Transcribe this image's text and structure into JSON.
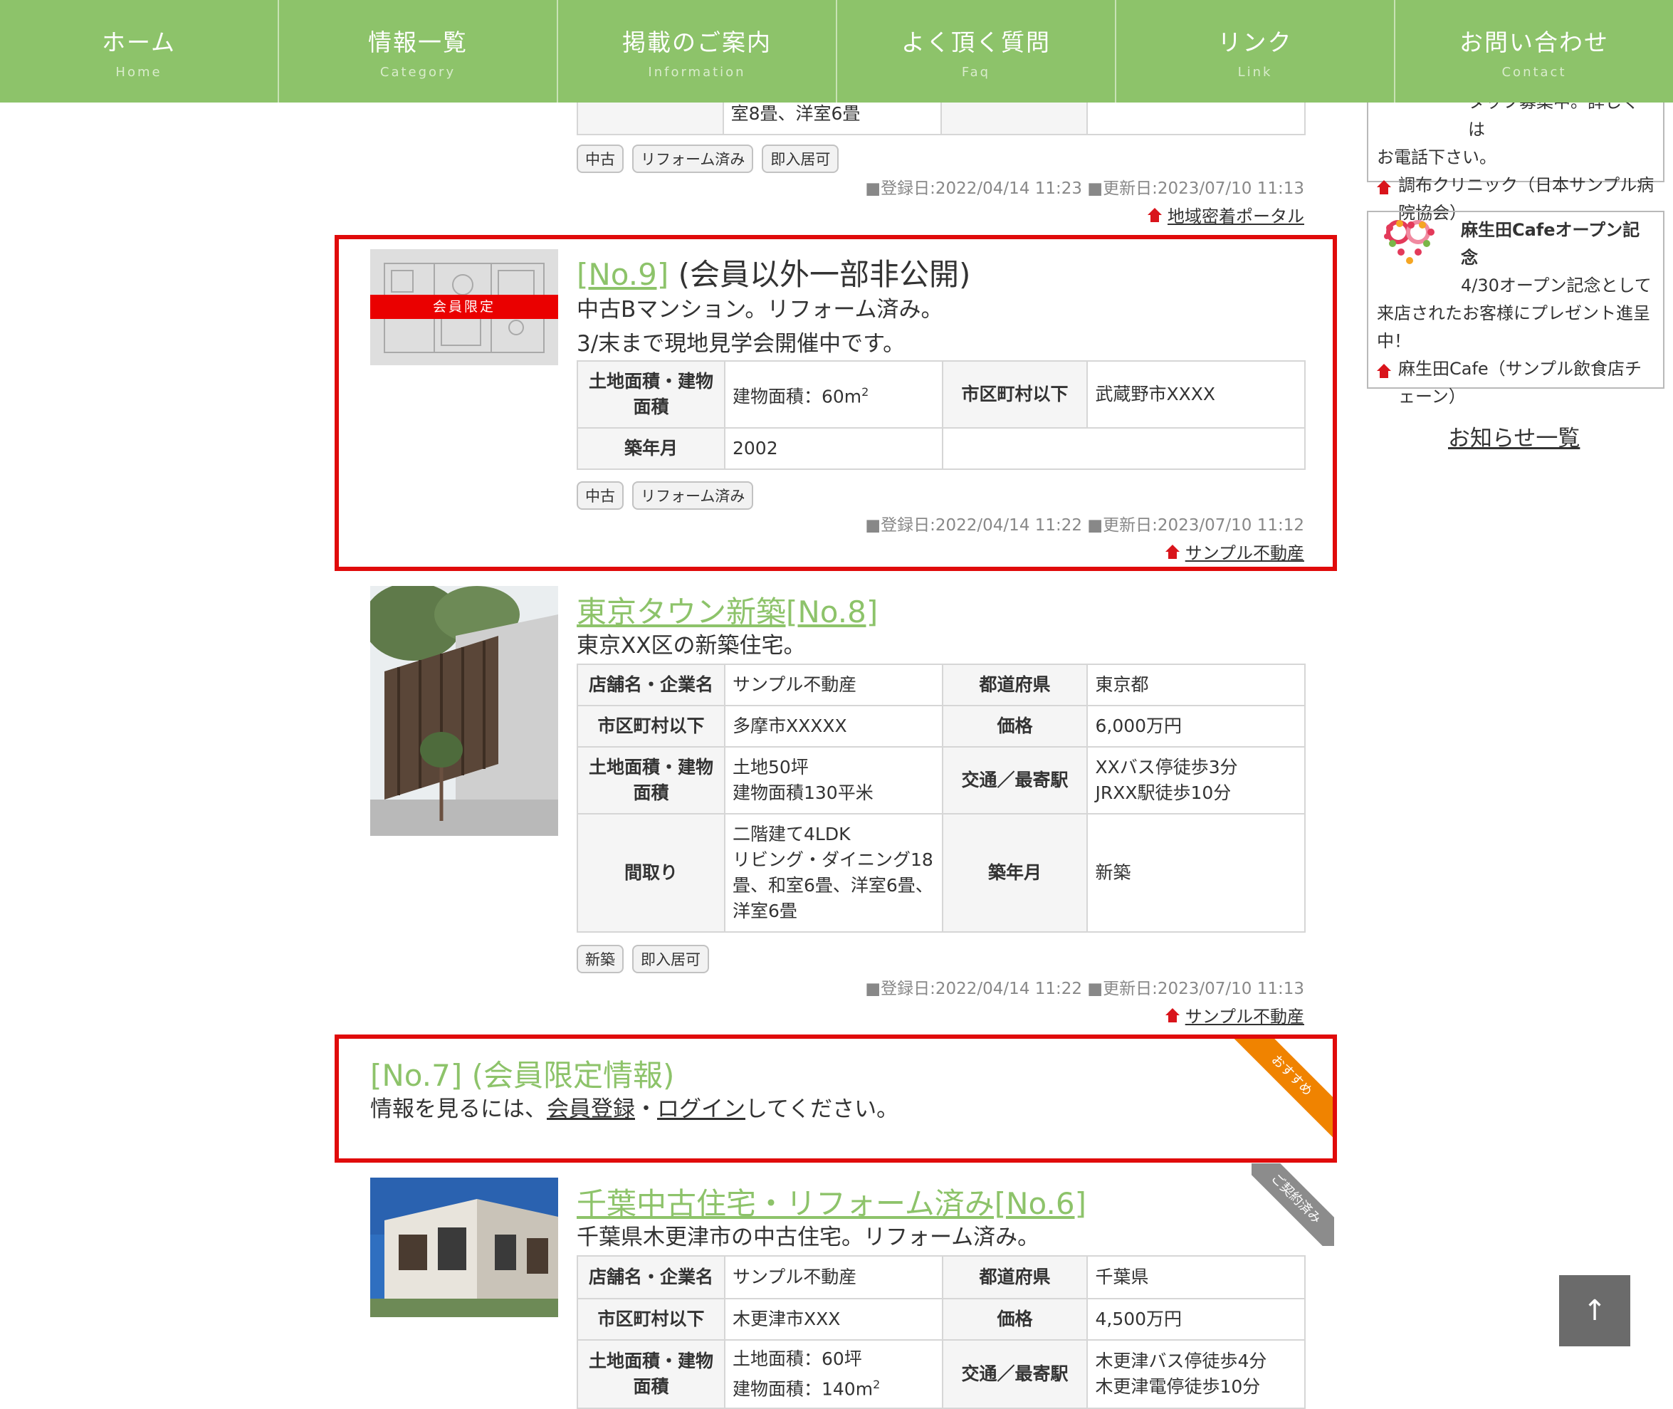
{
  "nav": [
    {
      "jp": "ホーム",
      "en": "Home"
    },
    {
      "jp": "情報一覧",
      "en": "Category"
    },
    {
      "jp": "掲載のご案内",
      "en": "Information"
    },
    {
      "jp": "よく頂く質問",
      "en": "Faq"
    },
    {
      "jp": "リンク",
      "en": "Link"
    },
    {
      "jp": "お問い合わせ",
      "en": "Contact"
    }
  ],
  "prev": {
    "madori_tail": "室8畳、洋室6畳",
    "tags": [
      "中古",
      "リフォーム済み",
      "即入居可"
    ],
    "dates": "■登録日:2022/04/14 11:23 ■更新日:2023/07/10 11:13",
    "source": "地域密着ポータル"
  },
  "no9": {
    "badge": "会員限定",
    "no": "[No.9]",
    "title_rest": "(会員以外一部非公開)",
    "desc1": "中古Bマンション。リフォーム済み。",
    "desc2": "3/末まで現地見学会開催中です。",
    "labels": {
      "area": "土地面積・建物面積",
      "city": "市区町村以下",
      "year": "築年月"
    },
    "area_prefix": "建物面積：60m",
    "area_sup": "2",
    "city": "武蔵野市XXXX",
    "year": "2002",
    "tags": [
      "中古",
      "リフォーム済み"
    ],
    "dates": "■登録日:2022/04/14 11:22 ■更新日:2023/07/10 11:12",
    "source": "サンプル不動産"
  },
  "no8": {
    "title": "東京タウン新築[No.8]",
    "desc": "東京XX区の新築住宅。",
    "labels": {
      "shop": "店舗名・企業名",
      "pref": "都道府県",
      "city": "市区町村以下",
      "price": "価格",
      "area": "土地面積・建物面積",
      "access": "交通／最寄駅",
      "madori": "間取り",
      "year": "築年月"
    },
    "shop": "サンプル不動産",
    "pref": "東京都",
    "city": "多摩市XXXXX",
    "price": "6,000万円",
    "area1": "土地50坪",
    "area2": "建物面積130平米",
    "access1": "XXバス停徒歩3分",
    "access2": "JRXX駅徒歩10分",
    "madori": [
      "二階建て4LDK",
      "リビング・ダイニング18",
      "畳、和室6畳、洋室6畳、",
      "洋室6畳"
    ],
    "year": "新築",
    "tags": [
      "新築",
      "即入居可"
    ],
    "dates": "■登録日:2022/04/14 11:22 ■更新日:2023/07/10 11:13",
    "source": "サンプル不動産"
  },
  "no7": {
    "title": "[No.7] (会員限定情報)",
    "text_pre": "情報を見るには、",
    "link_register": "会員登録",
    "sep": "・",
    "link_login": "ログイン",
    "text_post": "してください。",
    "ribbon": "おすすめ"
  },
  "no6": {
    "title": "千葉中古住宅・リフォーム済み[No.6]",
    "desc": "千葉県木更津市の中古住宅。リフォーム済み。",
    "ribbon": "ご契約済み",
    "shop": "サンプル不動産",
    "pref": "千葉県",
    "city": "木更津市XXX",
    "price": "4,500万円",
    "area1": "土地面積：60坪",
    "area2_prefix": "建物面積：140m",
    "area2_sup": "2",
    "access1": "木更津バス停徒歩4分",
    "access2": "木更津電停徒歩10分"
  },
  "sidebar": {
    "top_fragment": "タッフ募集中。詳しくは",
    "top_line2": "お電話下さい。",
    "top_source": "調布クリニック（日本サンプル病院協会）",
    "cafe_title": "麻生田Cafeオープン記念",
    "cafe_text": "4/30オープン記念として来店されたお客様にプレゼント進呈中！",
    "cafe_source": "麻生田Cafe（サンプル飲食店チェーン）",
    "notice_link": "お知らせ一覧"
  },
  "totop": "↑",
  "colors": {
    "nav": "#8dc36a",
    "accent_red": "#e00b0b",
    "orange": "#f08300",
    "gray_ribbon": "#8c8c8c"
  }
}
